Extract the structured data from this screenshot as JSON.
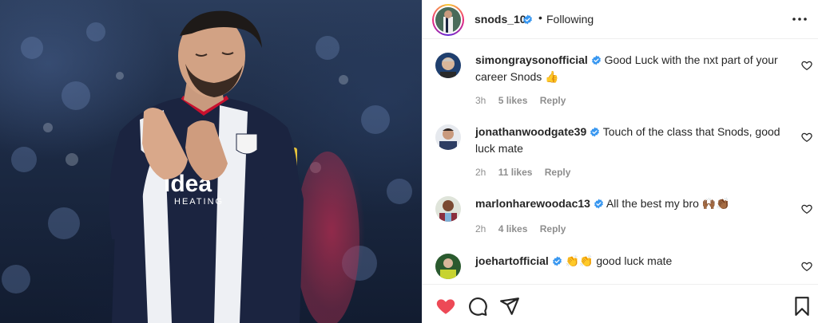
{
  "header": {
    "username": "snods_10",
    "separator": "•",
    "follow_status": "Following"
  },
  "comments": [
    {
      "username": "simongraysonofficial",
      "text": "Good Luck with the nxt part of your career Snods 👍",
      "time": "3h",
      "likes": "5 likes",
      "reply": "Reply",
      "avatar_color": "#b8a38a"
    },
    {
      "username": "jonathanwoodgate39",
      "text": "Touch of the class that Snods, good luck mate",
      "time": "2h",
      "likes": "11 likes",
      "reply": "Reply",
      "avatar_color": "#3e4f6e"
    },
    {
      "username": "marlonharewoodac13",
      "text": "All the best my bro 🙌🏾👏🏾",
      "time": "2h",
      "likes": "4 likes",
      "reply": "Reply",
      "avatar_color": "#8a2f3d"
    },
    {
      "username": "joehartofficial",
      "text": "👏👏 good luck mate",
      "time": "",
      "likes": "",
      "reply": "",
      "avatar_color": "#c7d330"
    }
  ],
  "icons": {
    "verified": "verified-badge-icon",
    "more": "more-options-icon",
    "comment_like": "heart-outline-icon",
    "like": "heart-filled-icon",
    "comment": "comment-icon",
    "share": "share-icon",
    "save": "bookmark-icon"
  },
  "colors": {
    "verified_blue": "#3897f0",
    "like_red": "#ed4956",
    "meta_gray": "#8e8e8e",
    "text": "#262626"
  }
}
